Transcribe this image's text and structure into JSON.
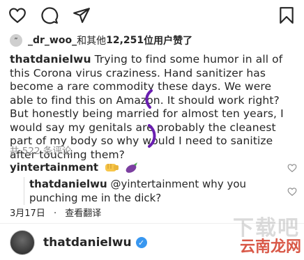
{
  "actions": {
    "like_icon": "heart-outline-icon",
    "comment_icon": "comment-icon",
    "share_icon": "send-icon",
    "save_icon": "bookmark-icon"
  },
  "likes": {
    "user": "_dr_woo_",
    "text": "和其他 ",
    "count": "12,251",
    "suffix": "位用户赞了"
  },
  "caption": {
    "username": "thatdanielwu",
    "text": "Trying to find some humor in all of this Corona virus craziness. Hand sanitizer has become a rare commodity these days. We were able to find this on Amazon. It should work right? But honestly being married for almost ten years, I would say my genitals are probably the cleanest part of my body so why would I need to sanitize after touching them?"
  },
  "comments_count": "共 522 条评论",
  "comment1": {
    "username": "yintertainment",
    "emoji": [
      "fist",
      "eggplant"
    ]
  },
  "reply": {
    "username": "thatdanielwu",
    "text": "@yintertainment why you punching me in the dick?"
  },
  "meta": {
    "date": "3月17日",
    "separator": "·",
    "translate": "查看翻译"
  },
  "footer": {
    "username": "thatdanielwu",
    "watermark_1": "下载吧",
    "watermark_2": "云南龙网"
  },
  "colors": {
    "text": "#262626",
    "secondary": "#8e8e8e",
    "verified": "#3897f0",
    "annotation": "#6a1fb0"
  }
}
